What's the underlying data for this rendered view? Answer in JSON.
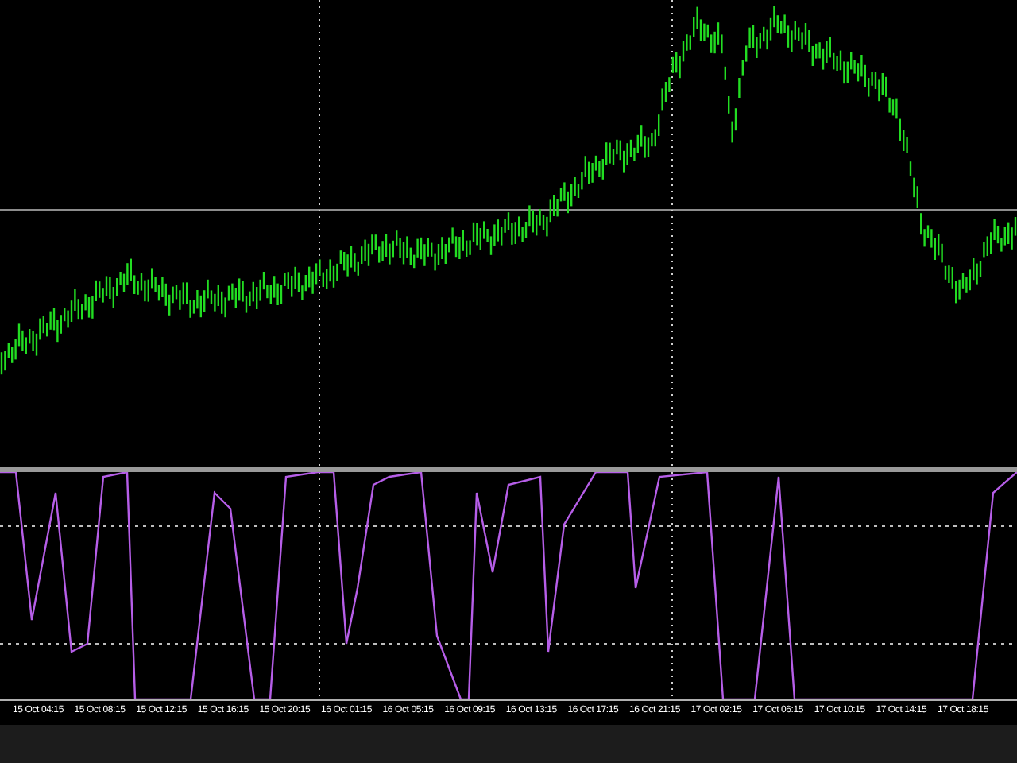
{
  "time_axis": {
    "labels": [
      "15 Oct 04:15",
      "15 Oct 08:15",
      "15 Oct 12:15",
      "15 Oct 16:15",
      "15 Oct 20:15",
      "16 Oct 01:15",
      "16 Oct 05:15",
      "16 Oct 09:15",
      "16 Oct 13:15",
      "16 Oct 17:15",
      "16 Oct 21:15",
      "17 Oct 02:15",
      "17 Oct 06:15",
      "17 Oct 10:15",
      "17 Oct 14:15",
      "17 Oct 18:15"
    ]
  }
}
